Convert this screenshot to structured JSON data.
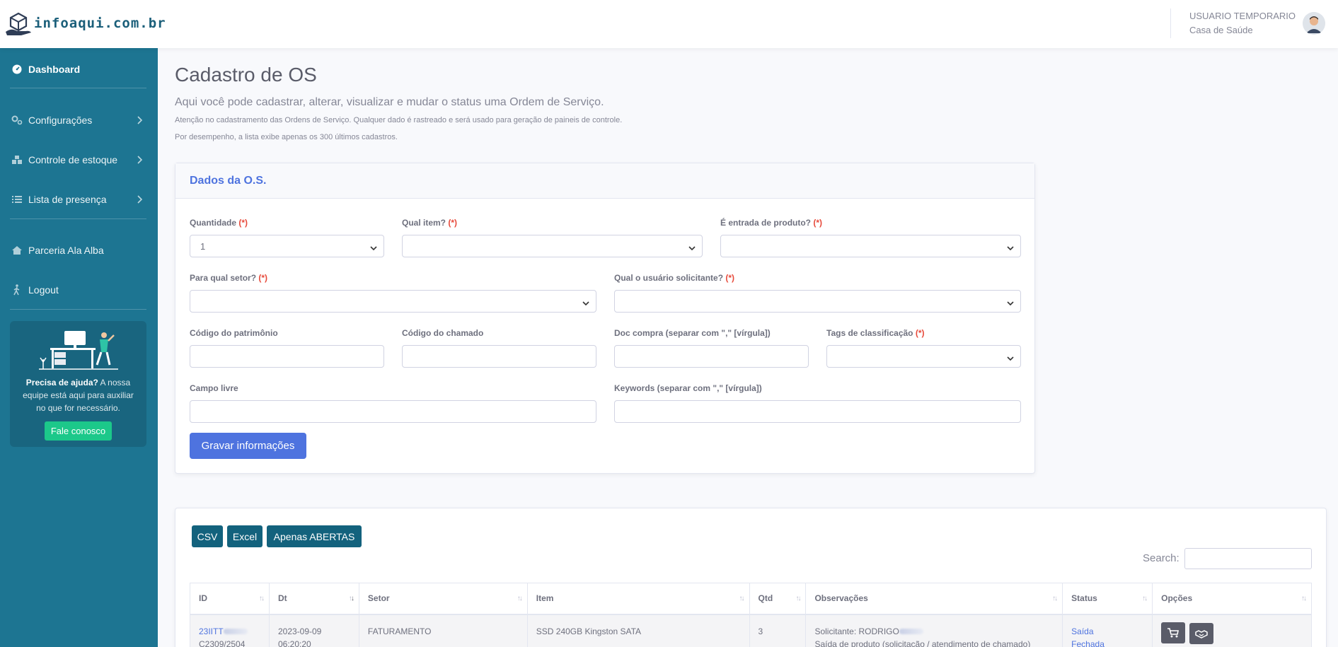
{
  "brand": {
    "name": "infoaqui.com.br"
  },
  "user": {
    "name": "USUARIO TEMPORARIO",
    "org": "Casa de Saúde"
  },
  "sidebar": {
    "items": [
      {
        "label": "Dashboard"
      },
      {
        "label": "Configurações"
      },
      {
        "label": "Controle de estoque"
      },
      {
        "label": "Lista de presença"
      },
      {
        "label": "Parceria Ala Alba"
      },
      {
        "label": "Logout"
      }
    ],
    "help": {
      "title": "Precisa de ajuda?",
      "text": "A nossa equipe está aqui para auxiliar no que for necessário.",
      "button": "Fale conosco"
    }
  },
  "page": {
    "title": "Cadastro de OS",
    "subtitle": "Aqui você pode cadastrar, alterar, visualizar e mudar o status uma Ordem de Serviço.",
    "note1": "Atenção no cadastramento das Ordens de Serviço. Qualquer dado é rastreado e será usado para geração de paineis de controle.",
    "note2": "Por desempenho, a lista exibe apenas os 300 últimos cadastros."
  },
  "form": {
    "header": "Dados da O.S.",
    "required_mark": "(*)",
    "quantidade": {
      "label": "Quantidade",
      "value": "1"
    },
    "qual_item": {
      "label": "Qual item?"
    },
    "entrada": {
      "label": "É entrada de produto?"
    },
    "setor": {
      "label": "Para qual setor?"
    },
    "usuario": {
      "label": "Qual o usuário solicitante?"
    },
    "patrimonio": {
      "label": "Código do patrimônio"
    },
    "chamado": {
      "label": "Código do chamado"
    },
    "doc_compra": {
      "label": "Doc compra (separar com \",\" [vírgula])"
    },
    "tags": {
      "label": "Tags de classificação"
    },
    "campo_livre": {
      "label": "Campo livre"
    },
    "keywords": {
      "label": "Keywords (separar com \",\" [vírgula])"
    },
    "submit": "Gravar informações"
  },
  "table": {
    "buttons": {
      "csv": "CSV",
      "excel": "Excel",
      "abertas": "Apenas ABERTAS"
    },
    "search_label": "Search:",
    "columns": [
      "ID",
      "Dt",
      "Setor",
      "Item",
      "Qtd",
      "Observações",
      "Status",
      "Opções"
    ],
    "rows": [
      {
        "id": "23IITT",
        "id_sub": "C2309/2504",
        "date": "2023-09-09",
        "time": "06:20:20",
        "setor": "FATURAMENTO",
        "item": "SSD 240GB Kingston SATA",
        "qtd": "3",
        "obs1": "Solicitante: RODRIGO",
        "obs2": "Saída de produto (solicitação / atendimento de chamado)",
        "status1": "Saída",
        "status2": "Fechada"
      }
    ]
  },
  "colors": {
    "sidebar": "#1d7592",
    "primary": "#4e73df",
    "export_button": "#13627d",
    "success": "#1cc88a",
    "required": "#e74a3b"
  }
}
